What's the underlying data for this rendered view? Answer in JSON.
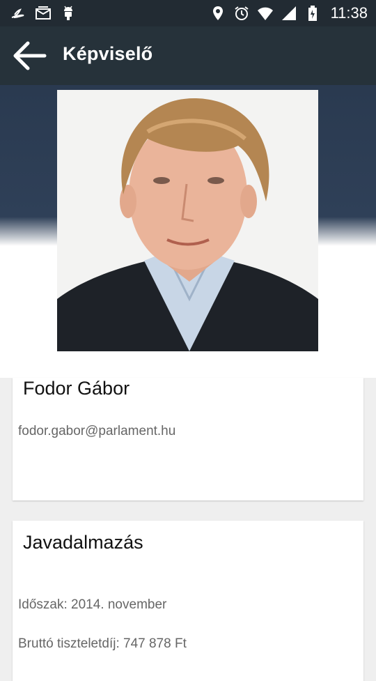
{
  "status_bar": {
    "time": "11:38",
    "left_icons": [
      "feather-icon",
      "mail-icon",
      "android-icon"
    ],
    "right_icons": [
      "location-icon",
      "alarm-icon",
      "wifi-icon",
      "signal-icon",
      "battery-icon"
    ]
  },
  "app_bar": {
    "title": "Képviselő",
    "back_icon": "arrow-left-icon"
  },
  "profile": {
    "photo": "portrait-photo",
    "name": "Fodor Gábor",
    "email": "fodor.gabor@parlament.hu"
  },
  "compensation": {
    "title": "Javadalmazás",
    "period": "Időszak: 2014. november",
    "gross": "Bruttó tiszteletdíj: 747 878 Ft"
  },
  "colors": {
    "app_bar": "#26323a",
    "status_bar": "#222b33",
    "background": "#efefef",
    "card": "#ffffff"
  }
}
